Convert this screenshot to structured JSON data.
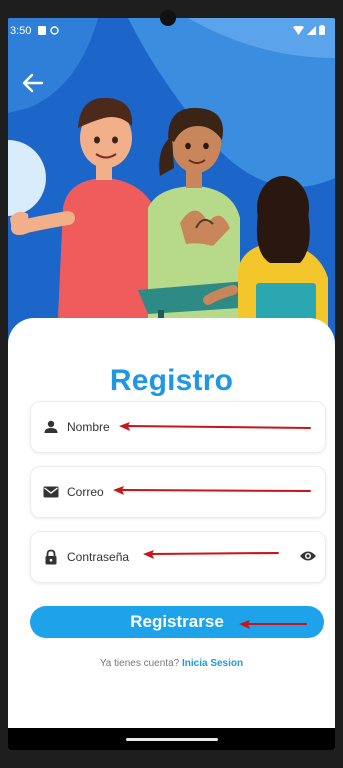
{
  "status_bar": {
    "time": "3:50",
    "icons": [
      "notification-icon",
      "sync-icon",
      "wifi-icon",
      "signal-icon",
      "battery-icon"
    ]
  },
  "header": {
    "back_icon": "arrow-left-icon"
  },
  "form": {
    "title": "Registro",
    "name_label": "Nombre",
    "email_label": "Correo",
    "password_label": "Contraseña",
    "submit_label": "Registrarse",
    "login_prompt": "Ya tienes cuenta?",
    "login_link": "Inicia Sesion"
  },
  "colors": {
    "accent": "#1e97e6",
    "button": "#1ea2ea",
    "hero_bg": "#1d66c9",
    "annotation_arrow": "#c8141a"
  }
}
